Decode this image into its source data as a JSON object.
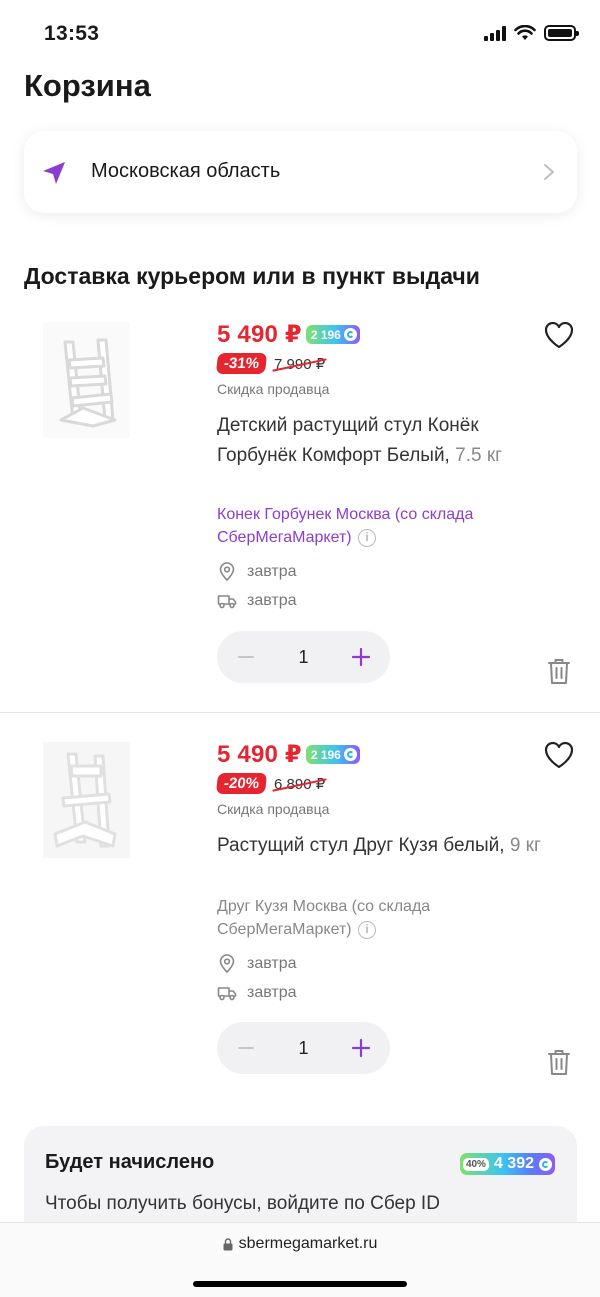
{
  "status_bar": {
    "time": "13:53"
  },
  "page": {
    "title": "Корзина"
  },
  "region": {
    "label": "Московская область"
  },
  "section": {
    "title": "Доставка курьером или в пункт выдачи"
  },
  "items": [
    {
      "price": "5 490 ₽",
      "bonus": "2 196",
      "discount": "-31%",
      "old_price": "7 990 ₽",
      "discount_note": "Скидка продавца",
      "name": "Детский растущий стул Конёк Горбунёк Комфорт Белый,",
      "weight": "7.5 кг",
      "seller": "Конек Горбунек Москва (со склада СберМегаМаркет)",
      "pickup": "завтра",
      "courier": "завтра",
      "quantity": "1"
    },
    {
      "price": "5 490 ₽",
      "bonus": "2 196",
      "discount": "-20%",
      "old_price": "6 890 ₽",
      "discount_note": "Скидка продавца",
      "name": "Растущий стул Друг Кузя белый,",
      "weight": "9 кг",
      "seller": "Друг Кузя Москва (со склада СберМегаМаркет)",
      "pickup": "завтра",
      "courier": "завтра",
      "quantity": "1"
    }
  ],
  "bonus_card": {
    "title": "Будет начислено",
    "percent": "40%",
    "amount": "4 392",
    "text": "Чтобы получить бонусы, войдите по Сбер ID"
  },
  "browser": {
    "url": "sbermegamarket.ru"
  },
  "colors": {
    "accent_red": "#e5252f",
    "accent_purple": "#8c3dd1"
  }
}
